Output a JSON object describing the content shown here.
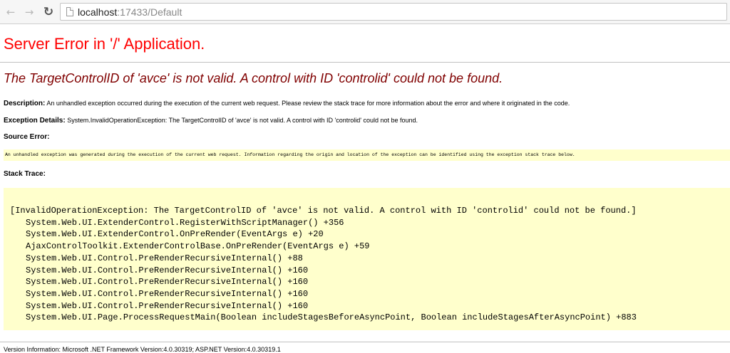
{
  "browser": {
    "back_icon": "back-arrow-icon",
    "forward_icon": "forward-arrow-icon",
    "reload_icon": "reload-icon",
    "url_host": "localhost",
    "url_rest": ":17433/Default"
  },
  "page": {
    "title": "Server Error in '/' Application.",
    "error_message": "The TargetControlID of 'avce' is not valid. A control with ID 'controlid' could not be found.",
    "description_label": "Description:",
    "description_text": "An unhandled exception occurred during the execution of the current web request. Please review the stack trace for more information about the error and where it originated in the code.",
    "exception_label": "Exception Details:",
    "exception_text": "System.InvalidOperationException: The TargetControlID of 'avce' is not valid. A control with ID 'controlid' could not be found.",
    "source_error_label": "Source Error:",
    "source_error_text": "An unhandled exception was generated during the execution of the current web request. Information regarding the origin and location of the exception can be identified using the exception stack trace below.",
    "stack_trace_label": "Stack Trace:",
    "stack_trace": [
      "[InvalidOperationException: The TargetControlID of 'avce' is not valid. A control with ID 'controlid' could not be found.]",
      "System.Web.UI.ExtenderControl.RegisterWithScriptManager() +356",
      "System.Web.UI.ExtenderControl.OnPreRender(EventArgs e) +20",
      "AjaxControlToolkit.ExtenderControlBase.OnPreRender(EventArgs e) +59",
      "System.Web.UI.Control.PreRenderRecursiveInternal() +88",
      "System.Web.UI.Control.PreRenderRecursiveInternal() +160",
      "System.Web.UI.Control.PreRenderRecursiveInternal() +160",
      "System.Web.UI.Control.PreRenderRecursiveInternal() +160",
      "System.Web.UI.Control.PreRenderRecursiveInternal() +160",
      "System.Web.UI.Page.ProcessRequestMain(Boolean includeStagesBeforeAsyncPoint, Boolean includeStagesAfterAsyncPoint) +883"
    ],
    "footer_text": "Version Information: Microsoft .NET Framework Version:4.0.30319; ASP.NET Version:4.0.30319.1"
  }
}
